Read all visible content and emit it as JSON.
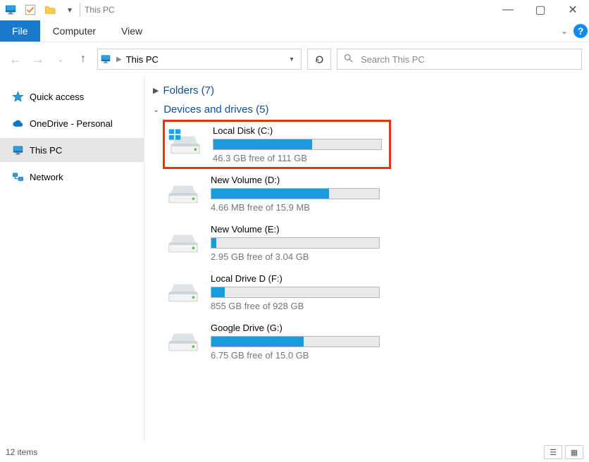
{
  "title": "This PC",
  "window_controls": {
    "min": "—",
    "max": "▢",
    "close": "✕"
  },
  "ribbon": {
    "file": "File",
    "tabs": [
      "Computer",
      "View"
    ]
  },
  "addressbar": {
    "location": "This PC"
  },
  "search": {
    "placeholder": "Search This PC"
  },
  "sidebar": {
    "items": [
      {
        "label": "Quick access",
        "icon": "star"
      },
      {
        "label": "OneDrive - Personal",
        "icon": "onedrive"
      },
      {
        "label": "This PC",
        "icon": "pc",
        "selected": true
      },
      {
        "label": "Network",
        "icon": "network"
      }
    ]
  },
  "groups": {
    "folders": {
      "label": "Folders",
      "count": 7,
      "expanded": false
    },
    "drives": {
      "label": "Devices and drives",
      "count": 5,
      "expanded": true
    }
  },
  "drives": [
    {
      "name": "Local Disk (C:)",
      "free_text": "46.3 GB free of 111 GB",
      "fill_pct": 59,
      "os": true,
      "highlight": true
    },
    {
      "name": "New Volume (D:)",
      "free_text": "4.66 MB free of 15.9 MB",
      "fill_pct": 70,
      "os": false
    },
    {
      "name": "New Volume (E:)",
      "free_text": "2.95 GB free of 3.04 GB",
      "fill_pct": 3,
      "os": false
    },
    {
      "name": "Local Drive D (F:)",
      "free_text": "855 GB free of 928 GB",
      "fill_pct": 8,
      "os": false
    },
    {
      "name": "Google Drive (G:)",
      "free_text": "6.75 GB free of 15.0 GB",
      "fill_pct": 55,
      "os": false
    }
  ],
  "status": {
    "items_text": "12 items"
  }
}
